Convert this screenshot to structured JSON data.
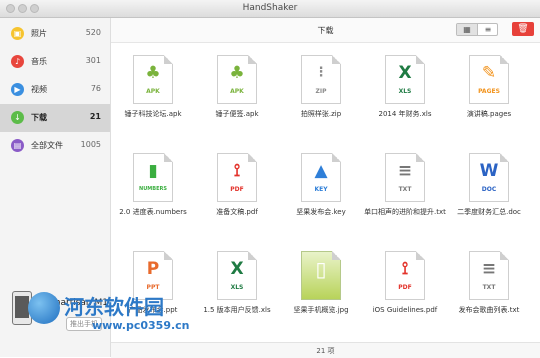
{
  "window": {
    "title": "HandShaker"
  },
  "sidebar": {
    "items": [
      {
        "label": "照片",
        "count": "520",
        "icon": "photo-icon",
        "color": "#f6c42f",
        "active": false
      },
      {
        "label": "音乐",
        "count": "301",
        "icon": "music-icon",
        "color": "#e8463d",
        "active": false
      },
      {
        "label": "视频",
        "count": "76",
        "icon": "video-icon",
        "color": "#3a8fe0",
        "active": false
      },
      {
        "label": "下载",
        "count": "21",
        "icon": "download-icon",
        "color": "#5cbc49",
        "active": true
      },
      {
        "label": "全部文件",
        "count": "1005",
        "icon": "files-icon",
        "color": "#8a5bc7",
        "active": false
      }
    ],
    "device": {
      "name": "Smartisan M1",
      "disconnect_label": "推出手机"
    }
  },
  "toolbar": {
    "title": "下载"
  },
  "files": [
    {
      "name": "锤子科技论坛.apk",
      "type": "APK",
      "color": "#7ab33c"
    },
    {
      "name": "锤子便签.apk",
      "type": "APK",
      "color": "#7ab33c"
    },
    {
      "name": "拍照样张.zip",
      "type": "ZIP",
      "color": "#8a8a8a"
    },
    {
      "name": "2014 年财务.xls",
      "type": "XLS",
      "color": "#1f7b43"
    },
    {
      "name": "演讲稿.pages",
      "type": "PAGES",
      "color": "#f2931c"
    },
    {
      "name": "2.0 进度表.numbers",
      "type": "NUMBERS",
      "color": "#3aae3f"
    },
    {
      "name": "准备文稿.pdf",
      "type": "PDF",
      "color": "#e3332b"
    },
    {
      "name": "坚果发布会.key",
      "type": "KEY",
      "color": "#2f7fd8"
    },
    {
      "name": "单口相声的进阶和提升.txt",
      "type": "TXT",
      "color": "#777777"
    },
    {
      "name": "二季度财务汇总.doc",
      "type": "DOC",
      "color": "#2b63c4"
    },
    {
      "name": "产品发布会.ppt",
      "type": "PPT",
      "color": "#e86a2c"
    },
    {
      "name": "1.5 版本用户反馈.xls",
      "type": "XLS",
      "color": "#1f7b43"
    },
    {
      "name": "坚果手机概览.jpg",
      "type": "JPG",
      "color": "#a9c94d"
    },
    {
      "name": "iOS Guidelines.pdf",
      "type": "PDF",
      "color": "#e3332b"
    },
    {
      "name": "发布会歌曲列表.txt",
      "type": "TXT",
      "color": "#777777"
    }
  ],
  "status": {
    "text": "21 项"
  },
  "watermark": {
    "line1": "河东软件园",
    "line2": "www.pc0359.cn"
  }
}
